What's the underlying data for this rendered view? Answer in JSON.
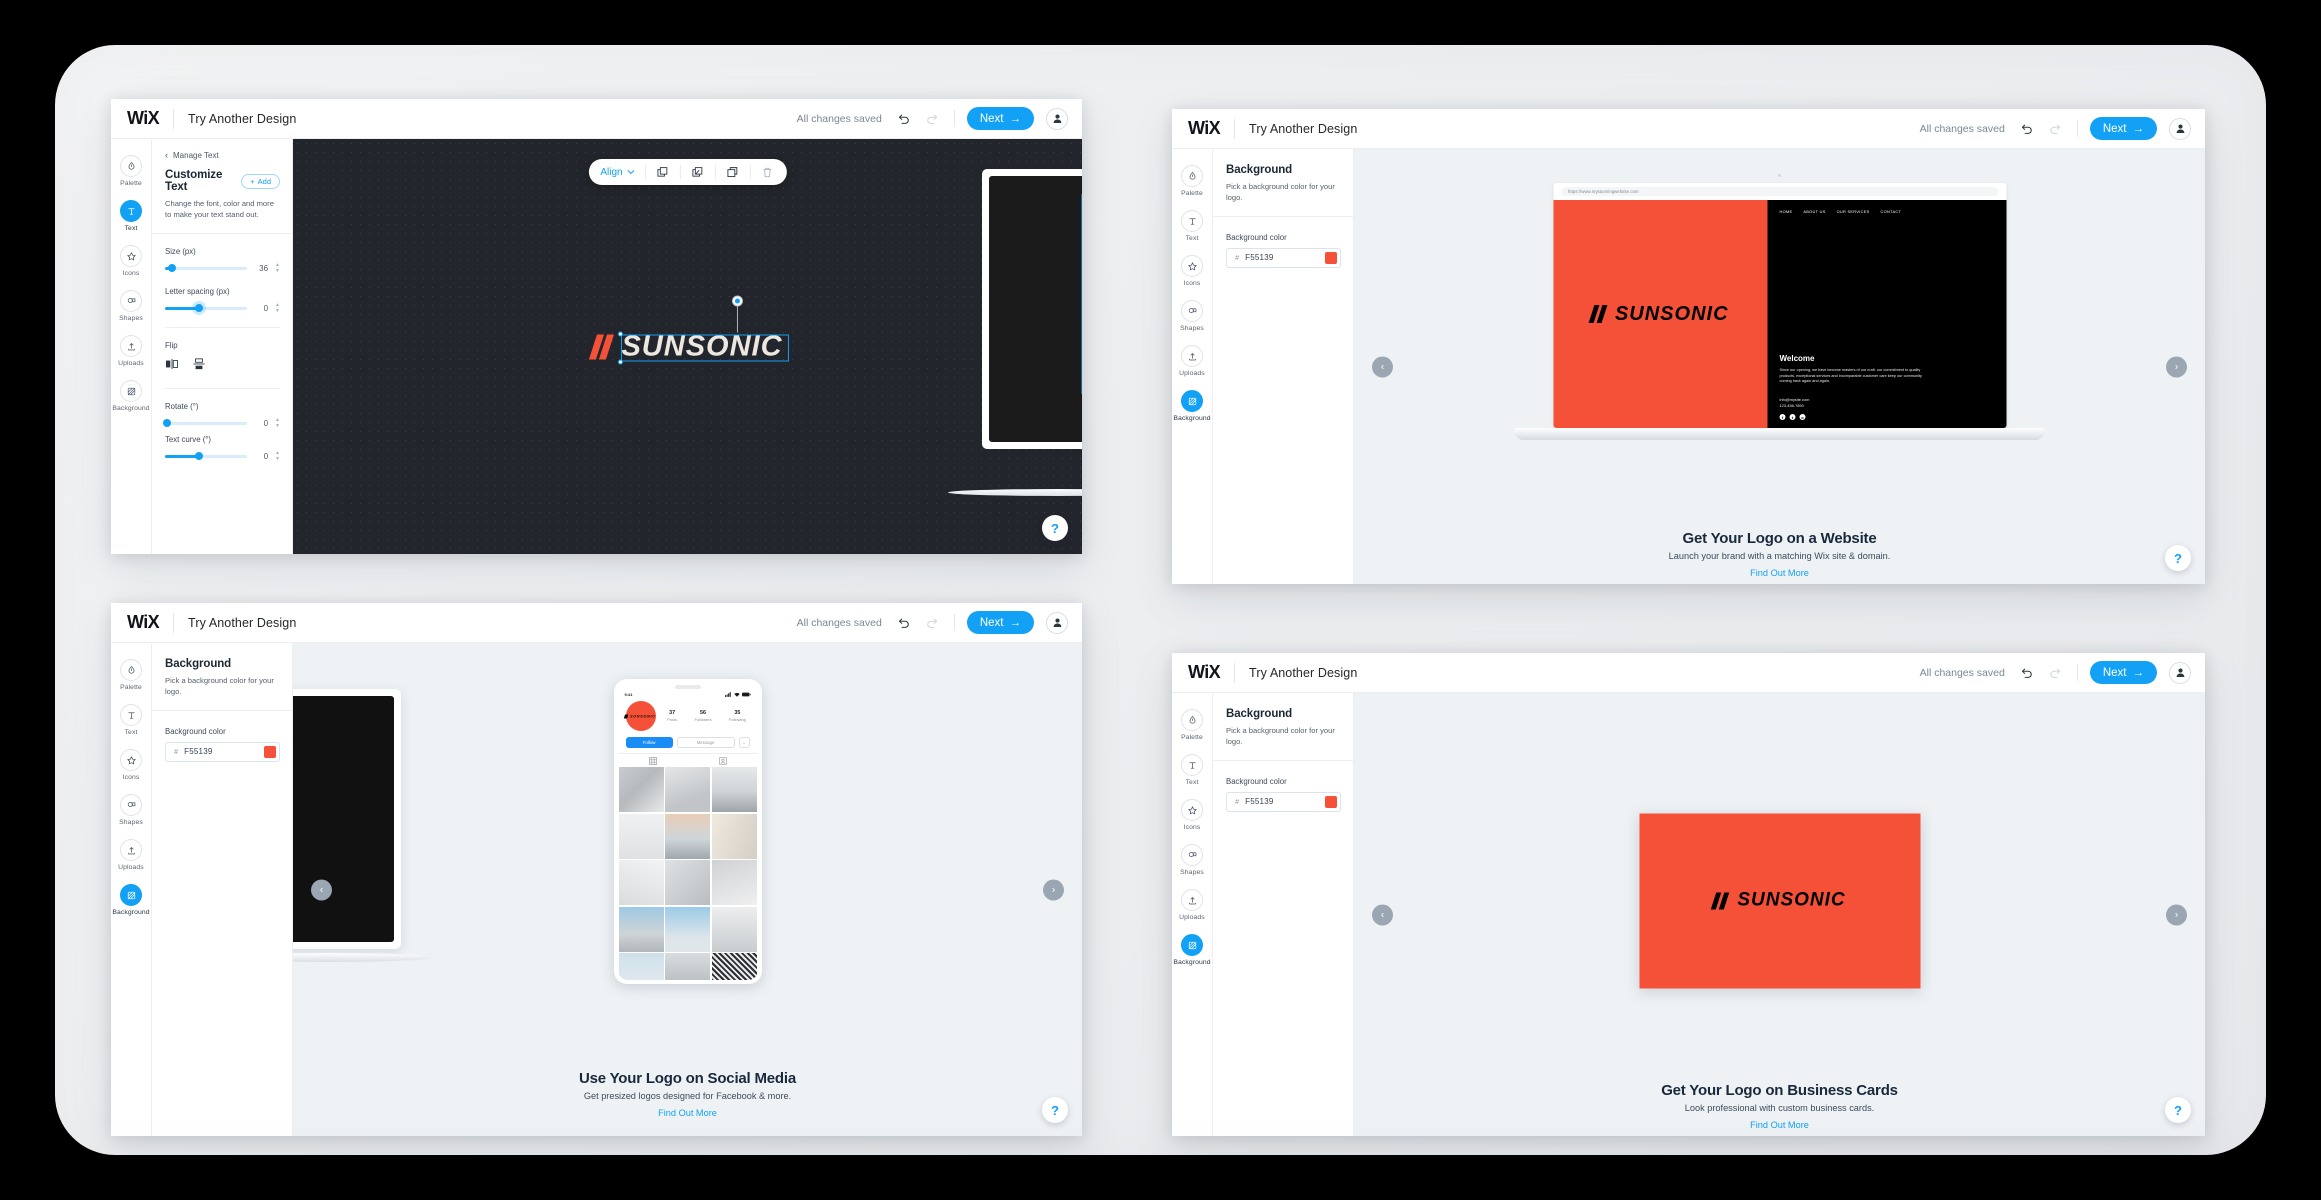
{
  "app": {
    "brand": "WiX",
    "header_title": "Try Another Design",
    "saved_status": "All changes saved",
    "next_label": "Next",
    "next_arrow": "→",
    "undo_icon": "undo-icon",
    "redo_icon": "redo-icon",
    "avatar_icon": "user-avatar-icon",
    "help_label": "?"
  },
  "colors": {
    "accent": "#12A1F5",
    "logo_red": "#F55139",
    "canvas_dark": "#22252B",
    "canvas_light": "#EEF2F5",
    "heading": "#19293C"
  },
  "sidebar": {
    "items": [
      {
        "label": "Palette",
        "icon": "droplet-icon",
        "active": false
      },
      {
        "label": "Text",
        "icon": "text-t-icon",
        "active": false
      },
      {
        "label": "Icons",
        "icon": "star-icon",
        "active": false
      },
      {
        "label": "Shapes",
        "icon": "shapes-icon",
        "active": false
      },
      {
        "label": "Uploads",
        "icon": "upload-icon",
        "active": false
      },
      {
        "label": "Background",
        "icon": "background-grid-icon",
        "active": true
      }
    ]
  },
  "logo": {
    "wordmark": "SUNSONIC",
    "mark": "//",
    "red": "#F55139"
  },
  "panel_text": {
    "back_label": "Manage Text",
    "back_chevron": "‹",
    "title": "Customize Text",
    "add_label": "Add",
    "add_plus": "+",
    "description": "Change the font, color and more to make your text stand out.",
    "controls": [
      {
        "label": "Size (px)",
        "value": "36",
        "fill_pct": 8
      },
      {
        "label": "Letter spacing (px)",
        "value": "0",
        "fill_pct": 42
      }
    ],
    "flip_label": "Flip",
    "flip_horizontal_icon": "flip-horizontal-icon",
    "flip_vertical_icon": "flip-vertical-icon",
    "controls2": [
      {
        "label": "Rotate (°)",
        "value": "0",
        "fill_pct": 2
      },
      {
        "label": "Text curve (°)",
        "value": "0",
        "fill_pct": 42
      }
    ]
  },
  "panel_background": {
    "title": "Background",
    "description": "Pick a background color for your logo.",
    "field_label": "Background color",
    "hash": "#",
    "color_value": "F55139",
    "swatch": "#F55139"
  },
  "align_toolbar": {
    "align_label": "Align",
    "chevron": "⌄",
    "tools": [
      {
        "icon": "duplicate-icon"
      },
      {
        "icon": "layers-icon"
      },
      {
        "icon": "copy-icon"
      },
      {
        "icon": "trash-icon"
      }
    ]
  },
  "nav": {
    "prev": "‹",
    "next": "›"
  },
  "windows": [
    {
      "id": "customize-text",
      "kind": "editor-dark",
      "panel": "text"
    },
    {
      "id": "logo-on-website",
      "kind": "website-mockup",
      "panel": "background",
      "promo": {
        "title": "Get Your Logo on a Website",
        "subtitle": "Launch your brand with a matching Wix site & domain.",
        "link": "Find Out More"
      },
      "mockup": {
        "url": "https://www.mystunningwebsite.com",
        "nav": [
          "HOME",
          "ABOUT US",
          "OUR SERVICES",
          "CONTACT"
        ],
        "heading": "Welcome",
        "paragraph": "Since our opening, we have become masters of our craft. our commitment to quality products, exceptional services and incomparable customer care keep our community coming back again and again.",
        "email": "info@mysite.com",
        "phone": "123-456-7890",
        "social": [
          "facebook-icon",
          "twitter-icon",
          "instagram-icon"
        ]
      }
    },
    {
      "id": "logo-on-social",
      "kind": "phone-mockup",
      "panel": "background",
      "promo": {
        "title": "Use Your Logo on Social Media",
        "subtitle": "Get presized logos designed for Facebook & more.",
        "link": "Find Out More"
      },
      "phone": {
        "time": "9:41",
        "signal_icons": "signal-wifi-battery-icon",
        "stats": [
          {
            "value": "37",
            "label": "Posts"
          },
          {
            "value": "56",
            "label": "Followers"
          },
          {
            "value": "35",
            "label": "Following"
          }
        ],
        "follow_label": "Follow",
        "message_label": "Message",
        "caret": "⌄",
        "tab_grid_icon": "grid-tab-icon",
        "tab_tagged_icon": "tagged-tab-icon"
      }
    },
    {
      "id": "logo-on-business-cards",
      "kind": "business-card",
      "panel": "background",
      "promo": {
        "title": "Get Your Logo on Business Cards",
        "subtitle": "Look professional with custom business cards.",
        "link": "Find Out More"
      }
    }
  ]
}
